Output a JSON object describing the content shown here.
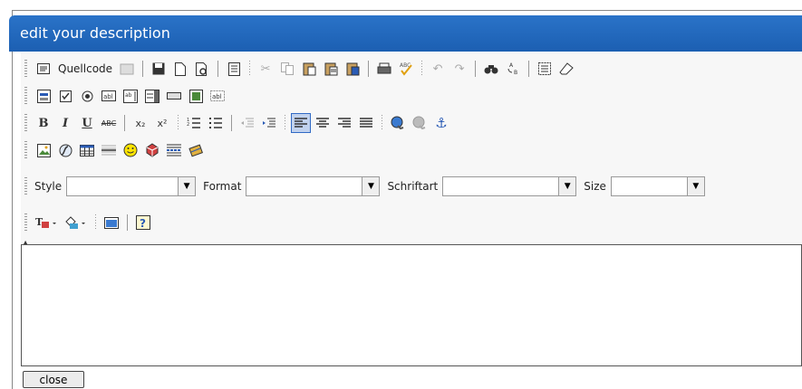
{
  "dialog": {
    "title": "edit your description",
    "close_label": "close"
  },
  "toolbar": {
    "source_label": "Quellcode",
    "combos": [
      {
        "label": "Style",
        "value": ""
      },
      {
        "label": "Format",
        "value": ""
      },
      {
        "label": "Schriftart",
        "value": ""
      },
      {
        "label": "Size",
        "value": ""
      }
    ],
    "bold": "B",
    "italic": "I",
    "underline": "U",
    "strike": "ABC",
    "subscript": "x₂",
    "superscript": "x²",
    "help": "?"
  },
  "content": {
    "text": ""
  },
  "colors": {
    "titlebar": "#1c5fb2",
    "active_border": "#316ac5",
    "active_fill": "#c1d2ee"
  }
}
